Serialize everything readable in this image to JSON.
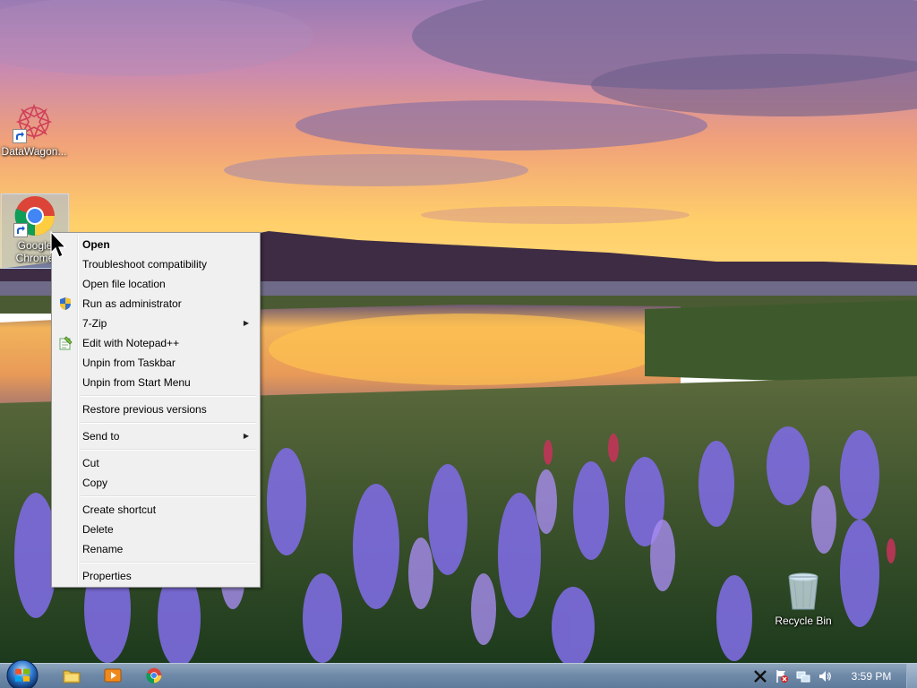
{
  "desktop": {
    "icons": [
      {
        "label": "DataWagon..."
      },
      {
        "label": "Google Chrome"
      },
      {
        "label": "Recycle Bin"
      }
    ]
  },
  "context_menu": {
    "items": [
      {
        "label": "Open"
      },
      {
        "label": "Troubleshoot compatibility"
      },
      {
        "label": "Open file location"
      },
      {
        "label": "Run as administrator",
        "icon": "uac-shield-icon"
      },
      {
        "label": "7-Zip",
        "submenu": true
      },
      {
        "label": "Edit with Notepad++",
        "icon": "notepadplusplus-icon"
      },
      {
        "label": "Unpin from Taskbar"
      },
      {
        "label": "Unpin from Start Menu"
      },
      {
        "label": "Restore previous versions"
      },
      {
        "label": "Send to",
        "submenu": true
      },
      {
        "label": "Cut"
      },
      {
        "label": "Copy"
      },
      {
        "label": "Create shortcut"
      },
      {
        "label": "Delete"
      },
      {
        "label": "Rename"
      },
      {
        "label": "Properties"
      }
    ],
    "submenu_arrow": "▶"
  },
  "taskbar": {
    "pinned": [
      {
        "icon": "file-explorer-icon"
      },
      {
        "icon": "media-player-icon"
      },
      {
        "icon": "chrome-icon"
      }
    ],
    "tray": [
      {
        "icon": "x-app-icon"
      },
      {
        "icon": "action-center-flag-icon"
      },
      {
        "icon": "network-icon"
      },
      {
        "icon": "volume-icon"
      }
    ],
    "clock": "3:59 PM"
  },
  "colors": {
    "menu_background": "#f0f0f0",
    "taskbar": "#6f8aa8",
    "selection": "#a0bee6"
  }
}
